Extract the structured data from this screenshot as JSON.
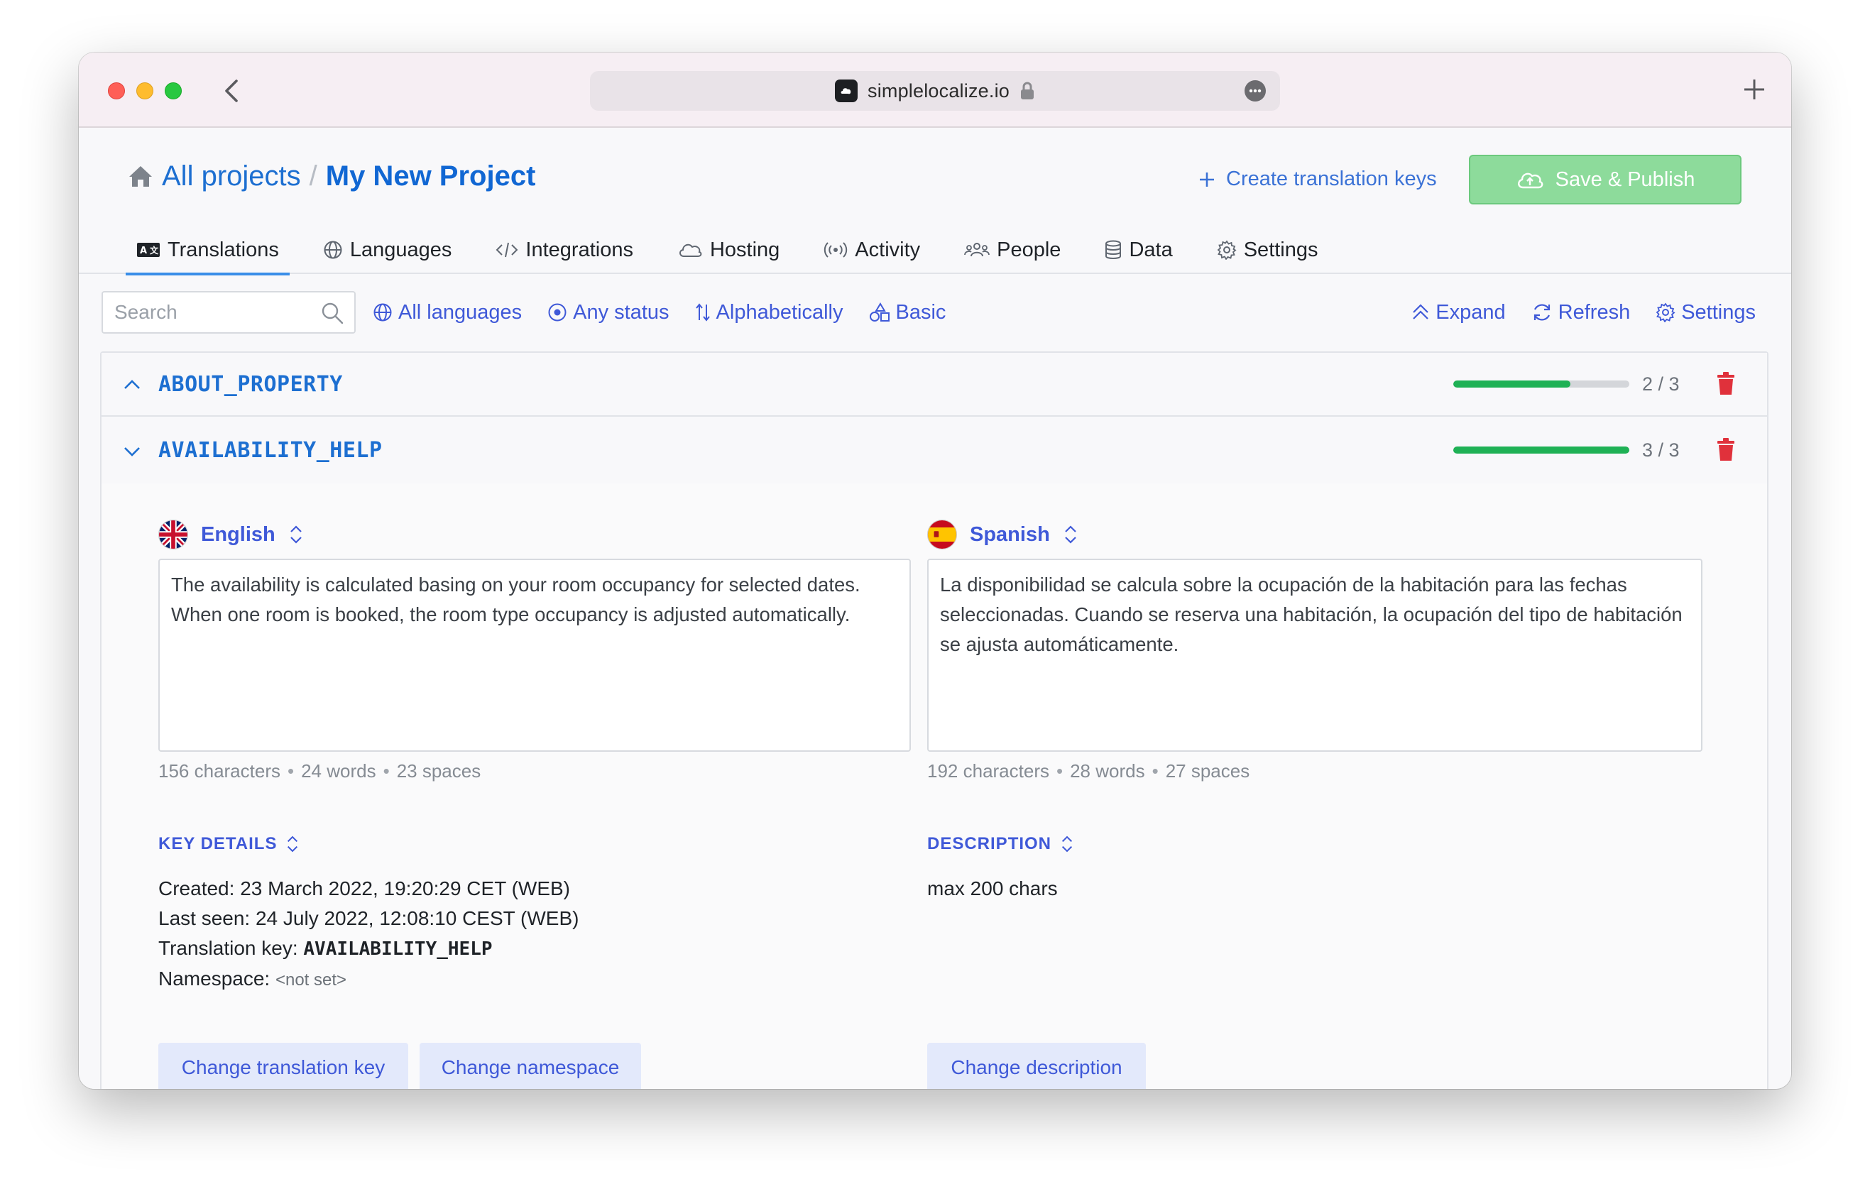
{
  "browser": {
    "url": "simplelocalize.io"
  },
  "header": {
    "breadcrumb_root": "All projects",
    "breadcrumb_sep": "/",
    "project_name": "My New Project",
    "create_keys_label": "Create translation keys",
    "save_publish_label": "Save & Publish"
  },
  "tabs": [
    {
      "label": "Translations",
      "icon": "translate-icon",
      "active": true
    },
    {
      "label": "Languages",
      "icon": "globe-icon"
    },
    {
      "label": "Integrations",
      "icon": "code-icon"
    },
    {
      "label": "Hosting",
      "icon": "cloud-icon"
    },
    {
      "label": "Activity",
      "icon": "broadcast-icon"
    },
    {
      "label": "People",
      "icon": "people-icon"
    },
    {
      "label": "Data",
      "icon": "database-icon"
    },
    {
      "label": "Settings",
      "icon": "gear-icon"
    }
  ],
  "toolbar": {
    "search_placeholder": "Search",
    "filters": [
      "All languages",
      "Any status",
      "Alphabetically",
      "Basic"
    ],
    "actions": [
      "Expand",
      "Refresh",
      "Settings"
    ]
  },
  "keys": [
    {
      "name": "ABOUT_PROPERTY",
      "progress_text": "2 / 3",
      "progress": 0.667,
      "expanded": false
    },
    {
      "name": "AVAILABILITY_HELP",
      "progress_text": "3 / 3",
      "progress": 1.0,
      "expanded": true
    }
  ],
  "translations": [
    {
      "language": "English",
      "flag": "uk-flag-icon",
      "text": "The availability is calculated basing on your room occupancy for selected dates. When one room is booked, the room type occupancy is adjusted automatically.",
      "characters": "156 characters",
      "words": "24 words",
      "spaces": "23 spaces"
    },
    {
      "language": "Spanish",
      "flag": "spain-flag-icon",
      "text": "La disponibilidad se calcula sobre la ocupación de la habitación para las fechas seleccionadas. Cuando se reserva una habitación, la ocupación del tipo de habitación se ajusta automáticamente.",
      "characters": "192 characters",
      "words": "28 words",
      "spaces": "27 spaces"
    }
  ],
  "key_details": {
    "title": "KEY DETAILS",
    "created_label": "Created:",
    "created_value": "23 March 2022, 19:20:29 CET (WEB)",
    "last_seen_label": "Last seen:",
    "last_seen_value": "24 July 2022, 12:08:10 CEST (WEB)",
    "key_label": "Translation key:",
    "key_value": "AVAILABILITY_HELP",
    "namespace_label": "Namespace:",
    "namespace_value": "<not set>",
    "change_key_button": "Change translation key",
    "change_namespace_button": "Change namespace"
  },
  "description": {
    "title": "DESCRIPTION",
    "value": "max 200 chars",
    "change_button": "Change description"
  },
  "colors": {
    "accent": "#3f59d8",
    "link": "#1d6fd1",
    "progress": "#1fb155",
    "save_button": "#8ddb9b",
    "delete": "#e0313b"
  }
}
